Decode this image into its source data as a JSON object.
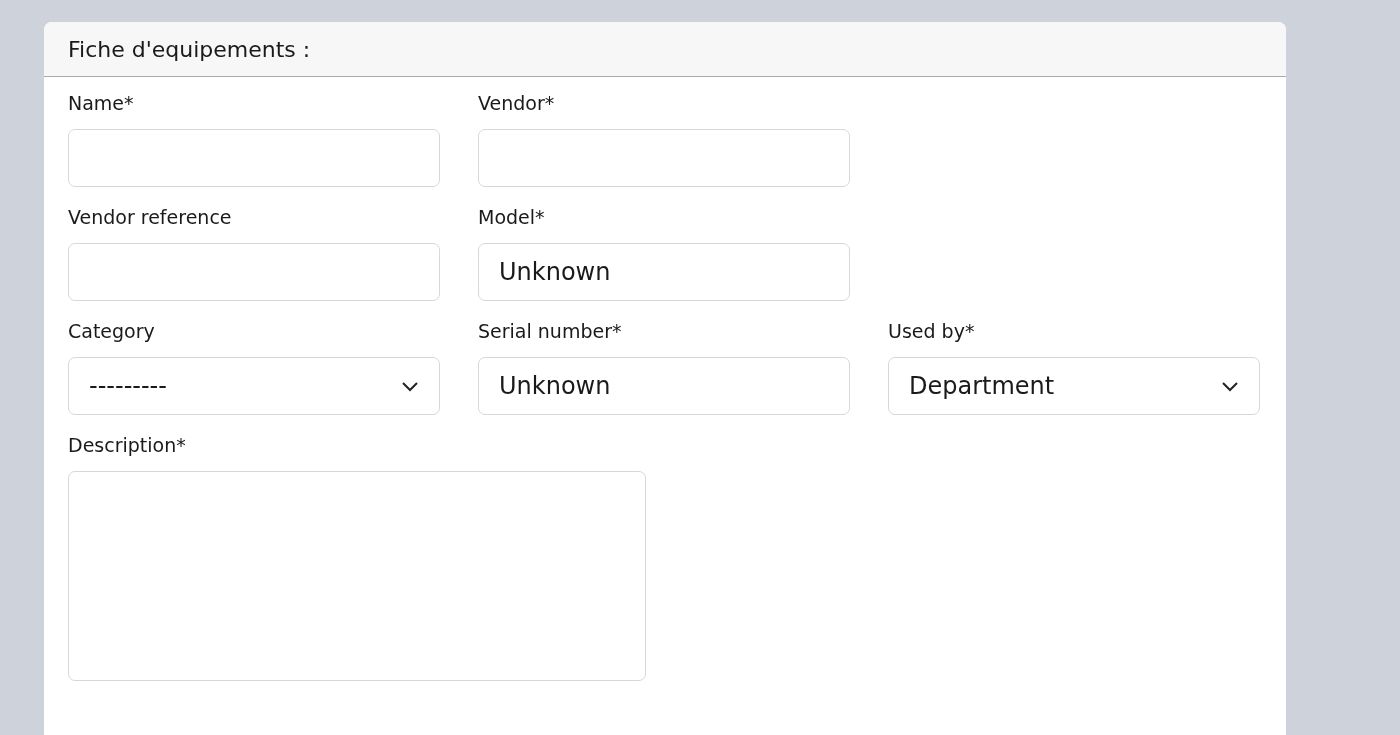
{
  "card": {
    "title": "Fiche d'equipements :"
  },
  "rows": [
    {
      "fields": [
        {
          "kind": "text",
          "label": "Name*"
        },
        {
          "kind": "text",
          "label": "Vendor*"
        }
      ]
    },
    {
      "fields": [
        {
          "kind": "text",
          "label": "Vendor reference"
        },
        {
          "kind": "text",
          "label": "Model*",
          "value": "Unknown"
        }
      ]
    },
    {
      "fields": [
        {
          "kind": "select",
          "label": "Category",
          "value": "---------"
        },
        {
          "kind": "text",
          "label": "Serial number*",
          "value": "Unknown"
        },
        {
          "kind": "select",
          "label": "Used by*",
          "value": "Department"
        }
      ]
    },
    {
      "fields": [
        {
          "kind": "textarea",
          "label": "Description*"
        }
      ]
    }
  ]
}
